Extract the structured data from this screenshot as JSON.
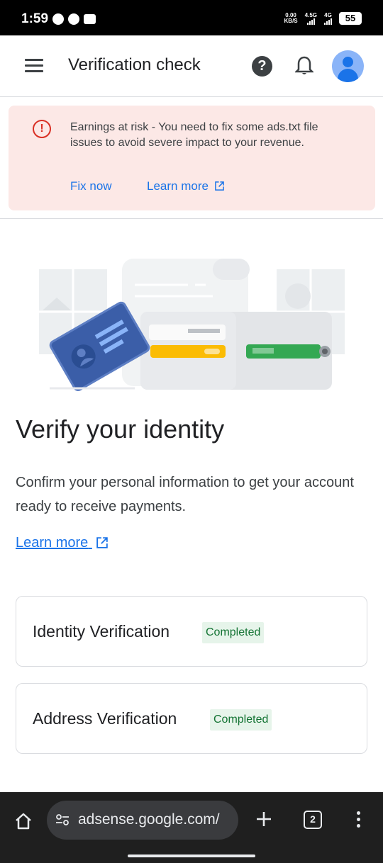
{
  "status_bar": {
    "time": "1:59",
    "net_speed_value": "0.00",
    "net_speed_unit": "KB/S",
    "sim1_label": "4.5G",
    "sim2_label": "4G",
    "battery": "55"
  },
  "header": {
    "title": "Verification check",
    "icons": [
      "menu-icon",
      "help-icon",
      "bell-icon",
      "avatar"
    ]
  },
  "alert": {
    "message": "Earnings at risk - You need to fix some ads.txt file issues to avoid severe impact to your revenue.",
    "fix_label": "Fix now",
    "learn_label": "Learn more",
    "icon": "error-icon",
    "color": "#d93025",
    "background": "#fce8e6"
  },
  "main": {
    "title": "Verify your identity",
    "description": "Confirm your personal information to get your account ready to receive payments.",
    "learn_more": "Learn more",
    "link_color": "#1a73e8"
  },
  "cards": [
    {
      "label": "Identity Verification",
      "status": "Completed"
    },
    {
      "label": "Address Verification",
      "status": "Completed"
    }
  ],
  "browser": {
    "url": "adsense.google.com/",
    "tab_count": "2",
    "icons": [
      "home-icon",
      "tune-icon",
      "plus-icon",
      "tabs-icon",
      "more-vert-icon"
    ]
  }
}
